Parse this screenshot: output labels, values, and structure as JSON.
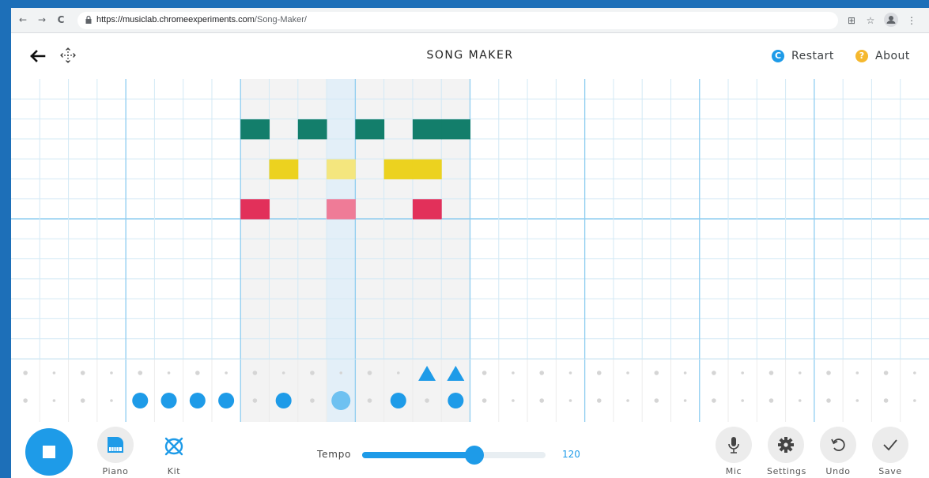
{
  "browser": {
    "url_host": "https://musiclab.chromeexperiments.com",
    "url_path": "/Song-Maker/",
    "back_glyph": "←",
    "forward_glyph": "→",
    "reload_glyph": "C",
    "star_glyph": "☆",
    "menu_glyph": "⋮",
    "qr_glyph": "⊞"
  },
  "header": {
    "title": "SONG MAKER",
    "restart_label": "Restart",
    "restart_glyph": "C",
    "about_label": "About",
    "about_glyph": "?"
  },
  "grid": {
    "columns": 32,
    "rows": 14,
    "bar_columns": 4,
    "shaded_columns": [
      8,
      9,
      10,
      11,
      12,
      13,
      14,
      15
    ],
    "highlight_column": 11,
    "octave_line_after_row": 7,
    "notes": [
      {
        "col": 8,
        "row": 2,
        "color": "#137e6b"
      },
      {
        "col": 10,
        "row": 2,
        "color": "#137e6b"
      },
      {
        "col": 12,
        "row": 2,
        "color": "#137e6b"
      },
      {
        "col": 14,
        "row": 2,
        "color": "#137e6b"
      },
      {
        "col": 15,
        "row": 2,
        "color": "#137e6b"
      },
      {
        "col": 9,
        "row": 4,
        "color": "#ecd21f"
      },
      {
        "col": 11,
        "row": 4,
        "color": "#f4e67e"
      },
      {
        "col": 13,
        "row": 4,
        "color": "#ecd21f"
      },
      {
        "col": 14,
        "row": 4,
        "color": "#ecd21f"
      },
      {
        "col": 8,
        "row": 6,
        "color": "#e2305a"
      },
      {
        "col": 11,
        "row": 6,
        "color": "#ef7b97"
      },
      {
        "col": 14,
        "row": 6,
        "color": "#e2305a"
      }
    ]
  },
  "rhythm": {
    "triangles": [
      14,
      15
    ],
    "circles": [
      4,
      5,
      6,
      7,
      9,
      11,
      13,
      15
    ],
    "light_circles": [
      11
    ]
  },
  "colors": {
    "accent": "#1e9be8",
    "accent_light": "#6ec1f1",
    "grid_line": "#d3e9f5",
    "bar_line": "#8fcdf0",
    "shade": "#f3f3f3",
    "highlight": "#e3eff8",
    "dot": "#d5d5d5"
  },
  "footer": {
    "piano_label": "Piano",
    "kit_label": "Kit",
    "tempo_label": "Tempo",
    "tempo_value": "120",
    "tempo_fraction": 0.61,
    "mic_label": "Mic",
    "settings_label": "Settings",
    "undo_label": "Undo",
    "save_label": "Save"
  },
  "icons": [
    "lock-icon",
    "back-arrow-icon",
    "move-icon",
    "restart-icon",
    "about-icon",
    "stop-icon",
    "piano-icon",
    "drum-icon",
    "mic-icon",
    "gear-icon",
    "undo-icon",
    "checkmark-icon"
  ]
}
